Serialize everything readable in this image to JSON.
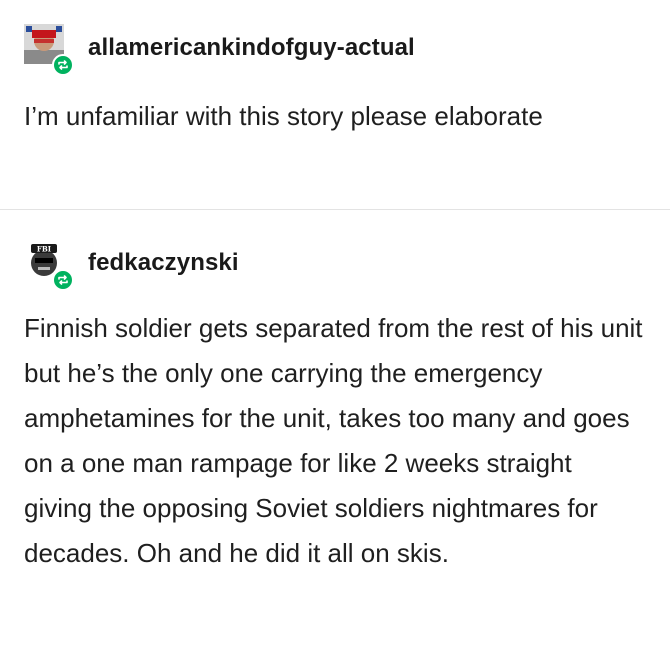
{
  "posts": [
    {
      "username": "allamericankindofguy-actual",
      "body": "I’m unfamiliar with this story please elaborate",
      "avatar_icon": "user-avatar-icon",
      "badge_icon": "reblog-icon",
      "badge_color": "#00b25f"
    },
    {
      "username": "fedkaczynski",
      "avatar_caption": "FBI",
      "body": "Finnish soldier gets separated from the rest of his unit but he’s the only one carrying the emergency amphetamines for the unit, takes too many and goes on a one man rampage for like 2 weeks straight giving the opposing Soviet soldiers nightmares for decades. Oh and he did it all on skis.",
      "avatar_icon": "user-avatar-icon",
      "badge_icon": "reblog-icon",
      "badge_color": "#00b25f"
    }
  ]
}
